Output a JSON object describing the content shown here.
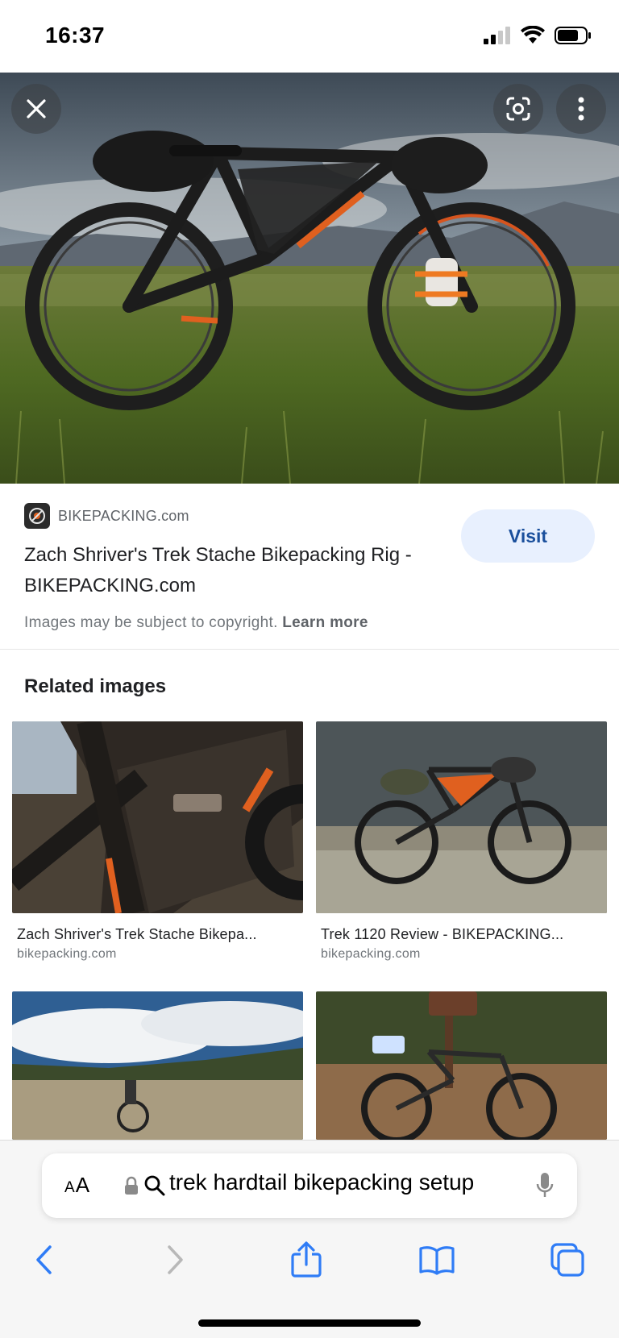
{
  "status_bar": {
    "time": "16:37"
  },
  "image_viewer": {
    "close_icon": "close-icon",
    "lens_icon": "google-lens-icon",
    "more_icon": "more-vert-icon"
  },
  "source": {
    "domain": "BIKEPACKING.com",
    "title": "Zach Shriver's Trek Stache Bikepacking Rig - BIKEPACKING.com",
    "visit_label": "Visit",
    "copyright_text": "Images may be subject to copyright.",
    "learn_more": "Learn more"
  },
  "related": {
    "heading": "Related images",
    "items": [
      {
        "title": "Zach Shriver's Trek Stache Bikepa...",
        "domain": "bikepacking.com"
      },
      {
        "title": "Trek 1120 Review - BIKEPACKING...",
        "domain": "bikepacking.com"
      },
      {
        "title": "",
        "domain": ""
      },
      {
        "title": "",
        "domain": ""
      }
    ]
  },
  "browser": {
    "text_size_label_big": "A",
    "text_size_label_small": "A",
    "address_text": "trek hardtail bikepacking setup"
  },
  "colors": {
    "accent": "#1a4f9c",
    "visit_bg": "#e8f0fe",
    "toolbar_icon": "#2f7cf6"
  }
}
